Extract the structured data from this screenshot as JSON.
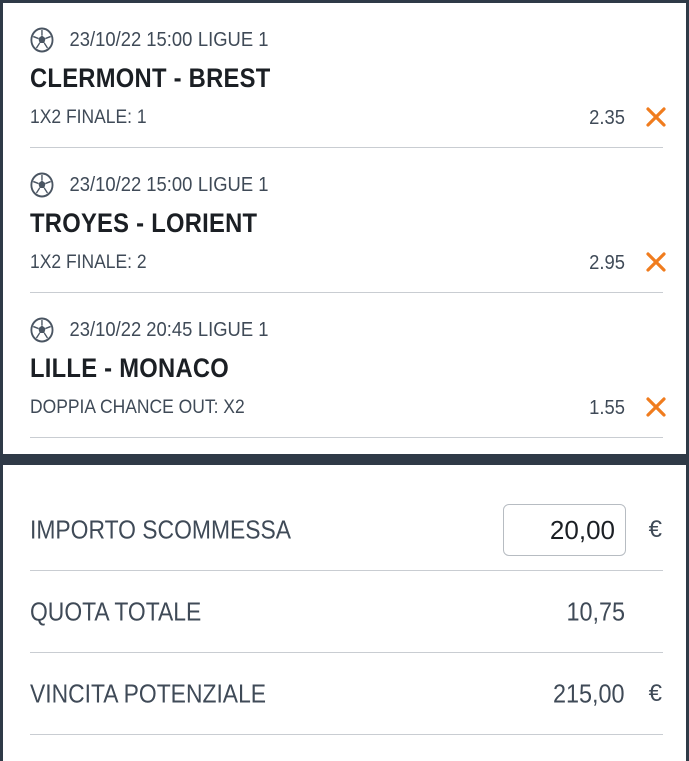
{
  "bets": [
    {
      "datetime": "23/10/22 15:00",
      "league": "LIGUE 1",
      "teams": "CLERMONT - BREST",
      "market": "1X2 FINALE: 1",
      "odd": "2.35"
    },
    {
      "datetime": "23/10/22 15:00",
      "league": "LIGUE 1",
      "teams": "TROYES - LORIENT",
      "market": "1X2 FINALE: 2",
      "odd": "2.95"
    },
    {
      "datetime": "23/10/22 20:45",
      "league": "LIGUE 1",
      "teams": "LILLE - MONACO",
      "market": "DOPPIA CHANCE OUT: X2",
      "odd": "1.55"
    }
  ],
  "summary": {
    "stake_label": "IMPORTO SCOMMESSA",
    "stake_value": "20,00",
    "currency": "€",
    "total_odds_label": "QUOTA TOTALE",
    "total_odds_value": "10,75",
    "potential_win_label": "VINCITA POTENZIALE",
    "potential_win_value": "215,00"
  },
  "colors": {
    "frame": "#2f3a47",
    "text": "#3f4a57",
    "title": "#1b1f24",
    "remove_accent": "#f07c1e",
    "separator": "#c9cdd2"
  },
  "icons": {
    "sport": "soccer-ball-icon",
    "remove": "close-icon"
  }
}
